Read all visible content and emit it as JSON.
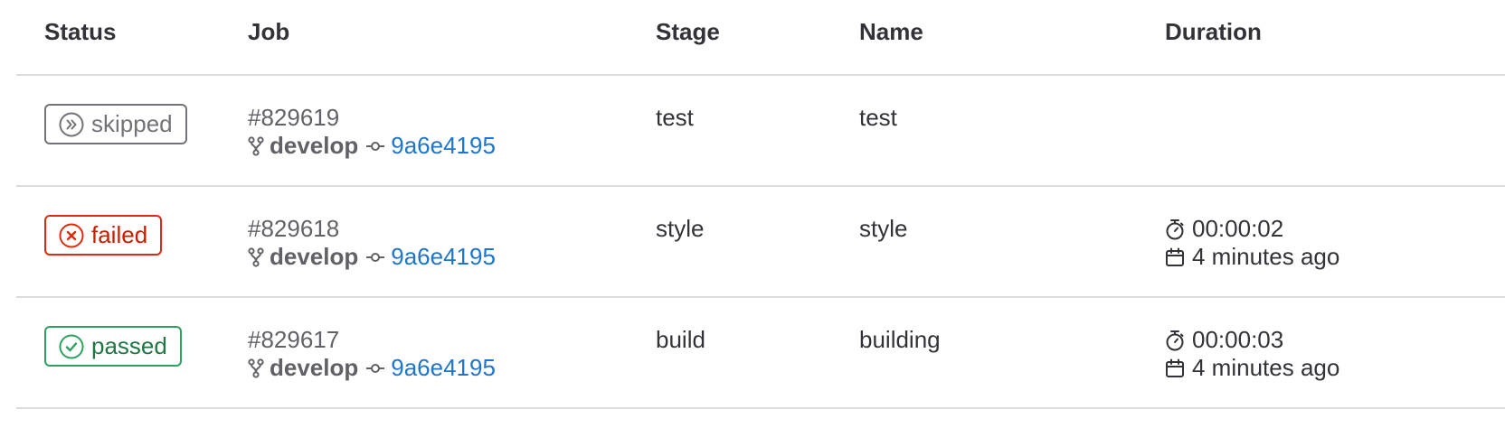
{
  "table": {
    "headers": {
      "status": "Status",
      "job": "Job",
      "stage": "Stage",
      "name": "Name",
      "duration": "Duration"
    },
    "rows": [
      {
        "status": "skipped",
        "status_icon": "skipped-icon",
        "job_id": "#829619",
        "branch": "develop",
        "commit_sha": "9a6e4195",
        "stage": "test",
        "name": "test",
        "duration": "",
        "finished": ""
      },
      {
        "status": "failed",
        "status_icon": "failed-icon",
        "job_id": "#829618",
        "branch": "develop",
        "commit_sha": "9a6e4195",
        "stage": "style",
        "name": "style",
        "duration": "00:00:02",
        "finished": "4 minutes ago"
      },
      {
        "status": "passed",
        "status_icon": "passed-icon",
        "job_id": "#829617",
        "branch": "develop",
        "commit_sha": "9a6e4195",
        "stage": "build",
        "name": "building",
        "duration": "00:00:03",
        "finished": "4 minutes ago"
      }
    ]
  },
  "colors": {
    "skipped": "#737278",
    "failed": "#dd2b0e",
    "passed": "#2da160",
    "link": "#1f75cb",
    "border": "#dcdcde"
  }
}
